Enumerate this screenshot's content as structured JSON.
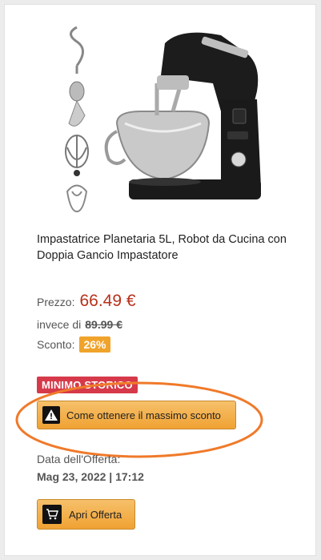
{
  "product": {
    "title": "Impastatrice Planetaria 5L, Robot da Cucina con Doppia Gancio Impastatore"
  },
  "pricing": {
    "price_label": "Prezzo:",
    "price_value": "66.49 €",
    "old_label": "invece di",
    "old_price": "89.99 €",
    "discount_label": "Sconto:",
    "discount_value": "26%"
  },
  "badges": {
    "minimo": "MINIMO STORICO"
  },
  "buttons": {
    "sconto_label": "Come ottenere il massimo sconto",
    "offer_label": "Apri Offerta"
  },
  "offer_date": {
    "label": "Data dell'Offerta:",
    "value": "Mag 23, 2022 | 17:12"
  },
  "colors": {
    "price": "#b8301a",
    "badge_red": "#d63a4a",
    "discount": "#f0a32b",
    "highlight_ellipse": "#f07a2a"
  },
  "icons": {
    "warning": "warning-icon",
    "cart": "cart-icon"
  }
}
